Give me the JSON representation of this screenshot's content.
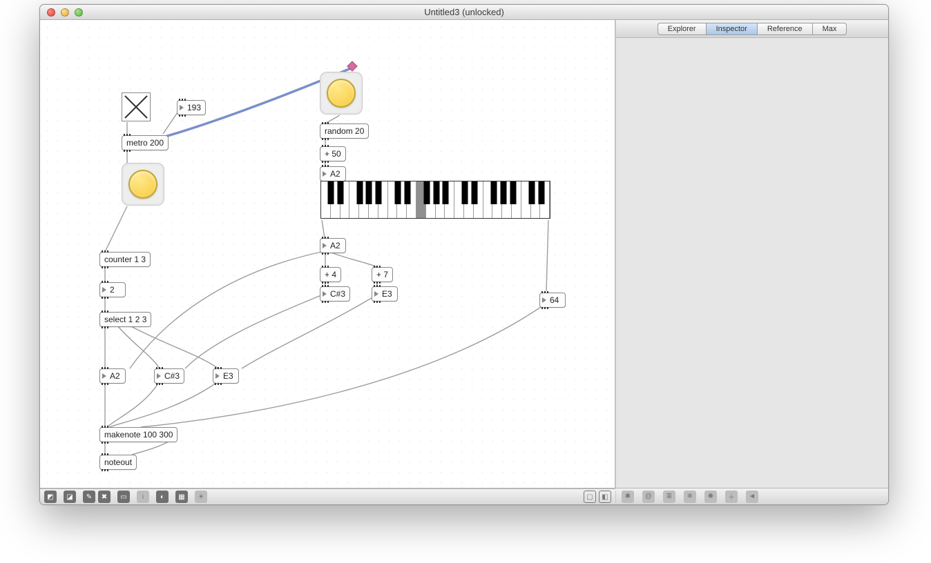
{
  "window": {
    "title": "Untitled3 (unlocked)"
  },
  "sidebar": {
    "tabs": [
      "Explorer",
      "Inspector",
      "Reference",
      "Max"
    ],
    "active": 1
  },
  "objects": {
    "metro": {
      "text": "metro 200"
    },
    "num193": {
      "value": "193"
    },
    "random": {
      "text": "random 20"
    },
    "plus50": {
      "text": "+ 50"
    },
    "nb_a2_top": {
      "value": "A2"
    },
    "nb_a2_mid": {
      "value": "A2"
    },
    "plus4": {
      "text": "+ 4"
    },
    "plus7": {
      "text": "+ 7"
    },
    "nb_cs3": {
      "value": "C#3"
    },
    "nb_e3": {
      "value": "E3"
    },
    "nb_64": {
      "value": "64"
    },
    "counter": {
      "text": "counter 1 3"
    },
    "nb_2": {
      "value": "2"
    },
    "select": {
      "text": "select 1 2 3"
    },
    "r_a2": {
      "value": "A2"
    },
    "r_cs3": {
      "value": "C#3"
    },
    "r_e3": {
      "value": "E3"
    },
    "makenote": {
      "text": "makenote 100 300"
    },
    "noteout": {
      "text": "noteout"
    }
  },
  "bottombar_icons": {
    "lock": "lock",
    "new": "new",
    "presentation": "presentation",
    "patching": "patching",
    "comment": "comment",
    "info": "i",
    "audio": "audio",
    "grid": "grid",
    "debug": "debug",
    "zoomfit": "zoomfit",
    "zoom": "zoom"
  },
  "sidebar_bottom_icons": {
    "freeze": "freeze",
    "attr": "attr",
    "list": "list",
    "snow": "snow",
    "sun": "sun",
    "plus": "plus",
    "back": "back"
  }
}
